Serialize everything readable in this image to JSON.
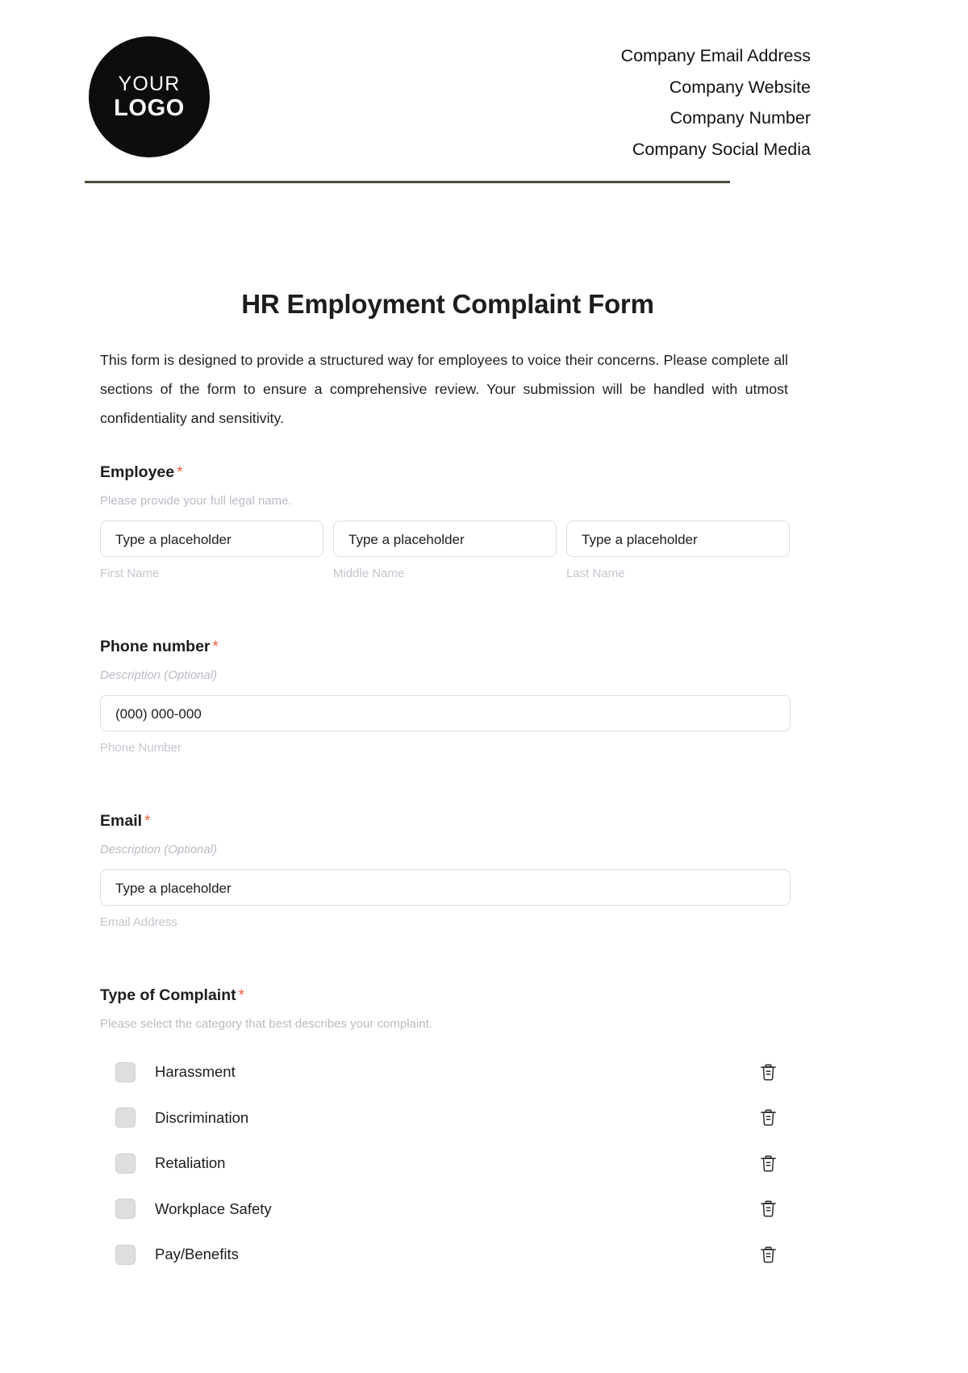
{
  "header": {
    "logo": {
      "line1": "YOUR",
      "line2": "LOGO",
      "alt": "your-logo"
    },
    "contacts": [
      "Company Email Address",
      "Company Website",
      "Company Number",
      "Company Social Media"
    ],
    "rule_color": "#4a4a38"
  },
  "document": {
    "title": "HR Employment Complaint Form",
    "intro": "This form is designed to provide a structured way for employees to voice their concerns. Please complete all sections of the form to ensure a comprehensive review. Your submission will be handled with utmost confidentiality and sensitivity."
  },
  "colors": {
    "required_star": "#f4603e",
    "muted_text": "#b9bcc4",
    "input_border": "#d9dde3",
    "checkbox_fill": "#dedede"
  },
  "fields": {
    "employee": {
      "label": "Employee",
      "required_marker": "*",
      "description": "Please provide your full legal name.",
      "inputs": [
        {
          "value": "Type a placeholder",
          "sub_label": "First Name"
        },
        {
          "value": "Type a placeholder",
          "sub_label": "Middle Name"
        },
        {
          "value": "Type a placeholder",
          "sub_label": "Last Name"
        }
      ]
    },
    "phone": {
      "label": "Phone number",
      "required_marker": "*",
      "description": "Description (Optional)",
      "value": "(000) 000-000",
      "sub_label": "Phone Number"
    },
    "email": {
      "label": "Email",
      "required_marker": "*",
      "description": "Description (Optional)",
      "value": "Type a placeholder",
      "sub_label": "Email Address"
    },
    "complaint_type": {
      "label": "Type of Complaint",
      "required_marker": "*",
      "description": "Please select the category that best describes your complaint.",
      "options": [
        {
          "label": "Harassment",
          "checked": false,
          "delete_icon": "trash-icon"
        },
        {
          "label": "Discrimination",
          "checked": false,
          "delete_icon": "trash-icon"
        },
        {
          "label": "Retaliation",
          "checked": false,
          "delete_icon": "trash-icon"
        },
        {
          "label": "Workplace Safety",
          "checked": false,
          "delete_icon": "trash-icon"
        },
        {
          "label": "Pay/Benefits",
          "checked": false,
          "delete_icon": "trash-icon"
        }
      ]
    }
  }
}
